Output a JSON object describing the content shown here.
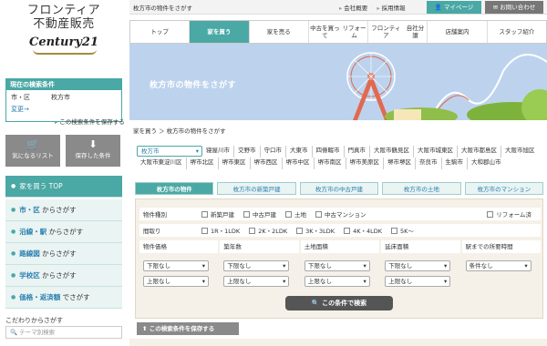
{
  "logo": {
    "line1": "フロンティア",
    "line2": "不動産販売",
    "brand": "Century21"
  },
  "conditions": {
    "title": "現在の検索条件",
    "key": "市・区",
    "value": "枚方市",
    "change": "変更→",
    "save": "この検索条件を保存する"
  },
  "icon_buttons": {
    "favorites": "気になるリスト",
    "saved": "保存した条件"
  },
  "side_nav": {
    "top": "家を買う TOP",
    "city_hl": "市・区",
    "city_rest": " からさがす",
    "line_hl": "沿線・駅",
    "line_rest": " からさがす",
    "route_hl": "路線図",
    "route_rest": " からさがす",
    "school_hl": "学校区",
    "school_rest": " からさがす",
    "price_hl": "価格・返済額",
    "price_rest": " でさがす"
  },
  "kodawari": "こだわりからさがす",
  "theme_search_placeholder": "テーマ別検索",
  "topbar": {
    "breadcrumb": "枚方市の物件をさがす",
    "links": [
      "会社概要",
      "採用情報"
    ],
    "mypage": "マイページ",
    "contact": "お問い合わせ"
  },
  "gnav": [
    {
      "l1": "トップ",
      "l2": ""
    },
    {
      "l1": "家を買う",
      "l2": ""
    },
    {
      "l1": "家を売る",
      "l2": ""
    },
    {
      "l1": "中古を買って",
      "l2": "リフォーム"
    },
    {
      "l1": "フロンティア",
      "l2": "自社分譲"
    },
    {
      "l1": "店舗案内",
      "l2": ""
    },
    {
      "l1": "スタッフ紹介",
      "l2": ""
    }
  ],
  "banner_title": "枚方市の物件をさがす",
  "breadcrumb2": "家を買う ＞ 枚方市の物件をさがす",
  "cities_row1": [
    "枚方市",
    "寝屋川市",
    "交野市",
    "守口市",
    "大東市",
    "四條畷市",
    "門真市",
    "大阪市鶴見区",
    "大阪市城東区",
    "大阪市都島区",
    "大阪市旭区"
  ],
  "cities_row2": [
    "大阪市東淀川区",
    "堺市北区",
    "堺市東区",
    "堺市西区",
    "堺市中区",
    "堺市南区",
    "堺市美原区",
    "堺市堺区",
    "奈良市",
    "生駒市",
    "大和郡山市"
  ],
  "tabs": [
    "枚方市の物件",
    "枚方市の新築戸建",
    "枚方市の中古戸建",
    "枚方市の土地",
    "枚方市のマンション"
  ],
  "search": {
    "type_label": "物件種別",
    "types": [
      "新築戸建",
      "中古戸建",
      "土地",
      "中古マンション"
    ],
    "reform": "リフォーム済",
    "layout_label": "間取り",
    "layouts": [
      "1R・1LDK",
      "2K・2LDK",
      "3K・3LDK",
      "4K・4LDK",
      "5K〜"
    ],
    "heads": [
      "物件価格",
      "築年数",
      "土地面積",
      "延床面積",
      "駅までの所要時間"
    ],
    "lower": "下限なし",
    "upper": "上限なし",
    "none": "条件なし",
    "button": "この条件で検索"
  },
  "save_button": "この検索条件を保存する",
  "colors": {
    "accent": "#4aa8a5",
    "banner": "#bdd3ed",
    "panel": "#f5f1e8"
  }
}
